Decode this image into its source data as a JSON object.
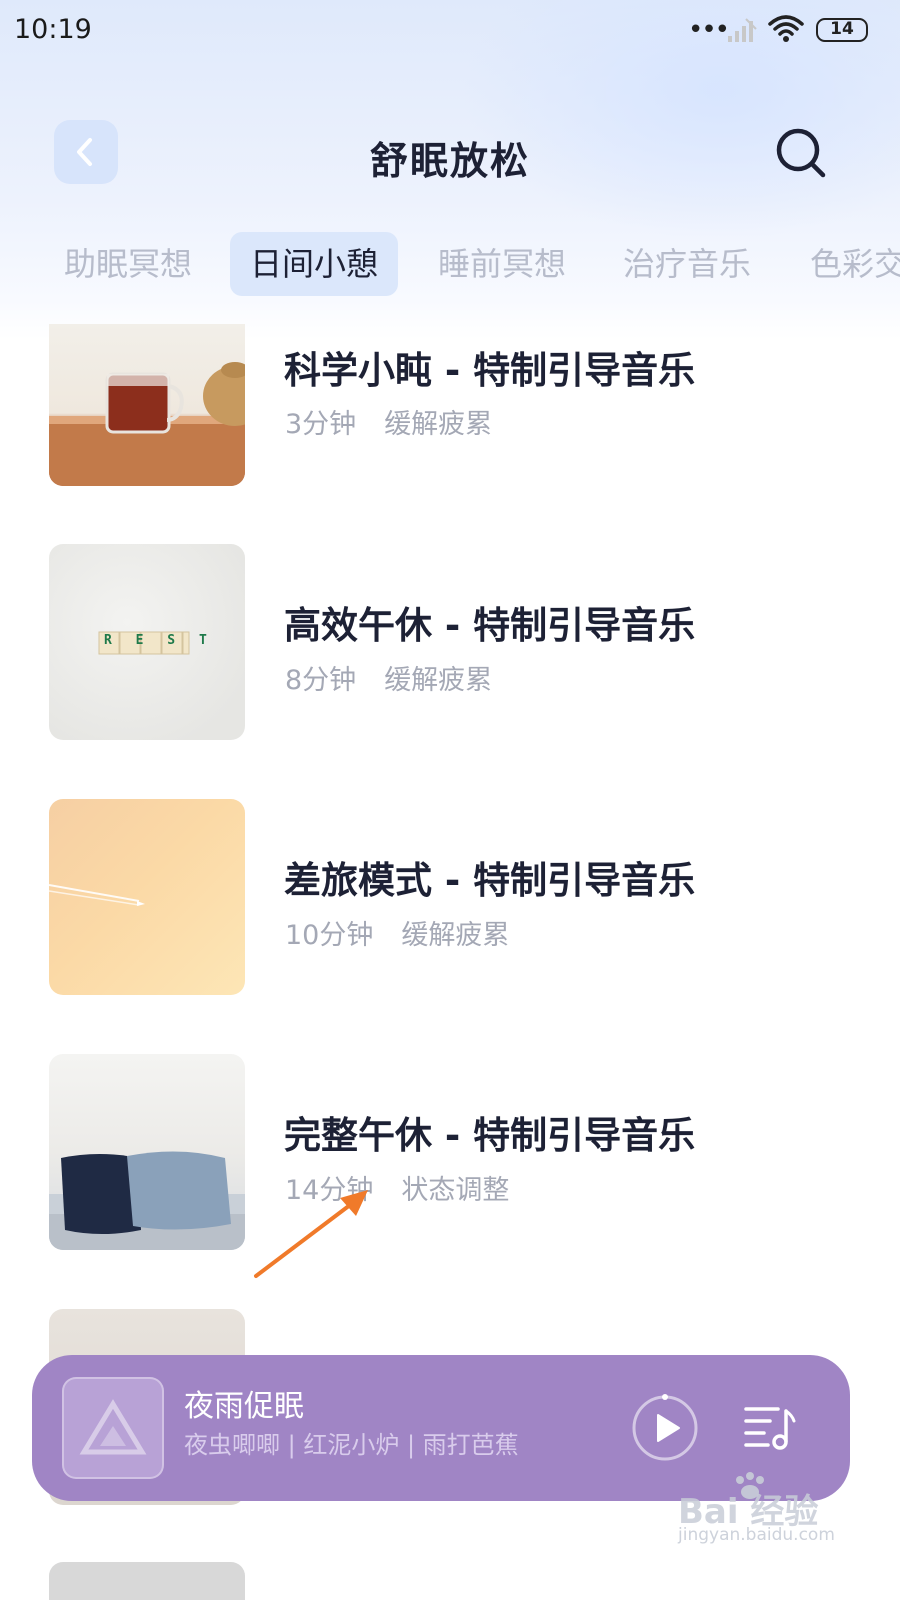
{
  "status_bar": {
    "time": "10:19",
    "dots": "•••",
    "battery": "14",
    "icons": [
      "signal-icon",
      "wifi-icon",
      "battery-icon"
    ]
  },
  "header": {
    "title": "舒眠放松",
    "back_icon": "chevron-left-icon",
    "search_icon": "search-icon"
  },
  "tabs": [
    {
      "label": "助眠冥想",
      "active": false
    },
    {
      "label": "日间小憩",
      "active": true
    },
    {
      "label": "睡前冥想",
      "active": false
    },
    {
      "label": "治疗音乐",
      "active": false
    },
    {
      "label": "色彩交",
      "active": false
    }
  ],
  "items": [
    {
      "title": "科学小盹 - 特制引导音乐",
      "duration": "3分钟",
      "tag": "缓解疲累"
    },
    {
      "title": "高效午休 - 特制引导音乐",
      "duration": "8分钟",
      "tag": "缓解疲累",
      "thumb_text": "R E S T"
    },
    {
      "title": "差旅模式 - 特制引导音乐",
      "duration": "10分钟",
      "tag": "缓解疲累"
    },
    {
      "title": "完整午休 - 特制引导音乐",
      "duration": "14分钟",
      "tag": "状态调整"
    }
  ],
  "player": {
    "title": "夜雨促眠",
    "subtitle": "夜虫唧唧 | 红泥小炉 | 雨打芭蕉",
    "play_icon": "play-icon",
    "playlist_icon": "playlist-icon"
  },
  "watermark": {
    "main": "Bai 经验",
    "sub": "jingyan.baidu.com"
  },
  "colors": {
    "accent": "#a085c5",
    "title": "#1d2135",
    "muted": "#a4a8b5",
    "tab_active_bg": "#dbe7fb",
    "annotation": "#f07a2a"
  }
}
